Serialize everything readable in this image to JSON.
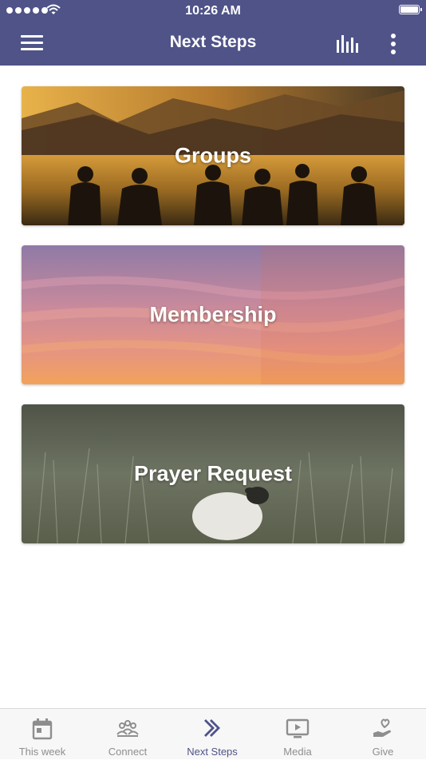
{
  "status_bar": {
    "time": "10:26 AM",
    "signal_icon": "signal-dots-icon",
    "wifi_icon": "wifi-icon",
    "battery_icon": "battery-icon"
  },
  "header": {
    "title": "Next Steps",
    "menu_icon": "hamburger-menu-icon",
    "stats_icon": "bar-chart-icon",
    "more_icon": "more-vertical-icon",
    "color": "#4f5388"
  },
  "cards": [
    {
      "label": "Groups",
      "image": "people-silhouettes-at-lake-sunset"
    },
    {
      "label": "Membership",
      "image": "pink-sunset-sky"
    },
    {
      "label": "Prayer Request",
      "image": "sheep-in-grass-field"
    }
  ],
  "tabbar": {
    "tabs": [
      {
        "label": "This week",
        "icon": "calendar-icon",
        "active": false
      },
      {
        "label": "Connect",
        "icon": "people-group-icon",
        "active": false
      },
      {
        "label": "Next Steps",
        "icon": "double-chevron-right-icon",
        "active": true
      },
      {
        "label": "Media",
        "icon": "play-screen-icon",
        "active": false
      },
      {
        "label": "Give",
        "icon": "heart-in-hand-icon",
        "active": false
      }
    ],
    "active_color": "#4f5388",
    "inactive_color": "#8e8e8e"
  }
}
